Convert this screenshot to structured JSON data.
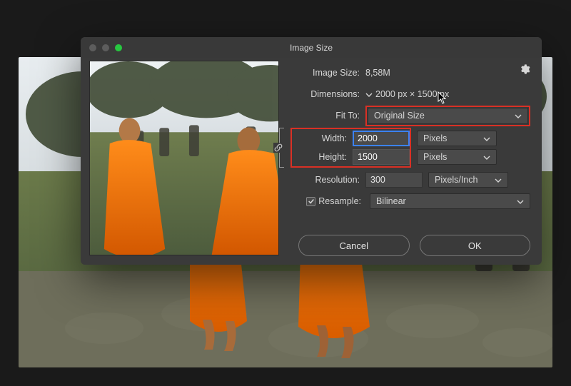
{
  "dialog": {
    "title": "Image Size",
    "image_size_label": "Image Size:",
    "image_size_value": "8,58M",
    "dimensions_label": "Dimensions:",
    "dimensions_value": "2000 px × 1500 px",
    "fit_to_label": "Fit To:",
    "fit_to_value": "Original Size",
    "width_label": "Width:",
    "width_value": "2000",
    "width_unit": "Pixels",
    "height_label": "Height:",
    "height_value": "1500",
    "height_unit": "Pixels",
    "resolution_label": "Resolution:",
    "resolution_value": "300",
    "resolution_unit": "Pixels/Inch",
    "resample_label": "Resample:",
    "resample_checked": true,
    "resample_value": "Bilinear",
    "cancel_label": "Cancel",
    "ok_label": "OK"
  },
  "colors": {
    "highlight": "#d93025",
    "dialog_bg": "#3a3a3a",
    "body_bg": "#1a1a1a"
  }
}
